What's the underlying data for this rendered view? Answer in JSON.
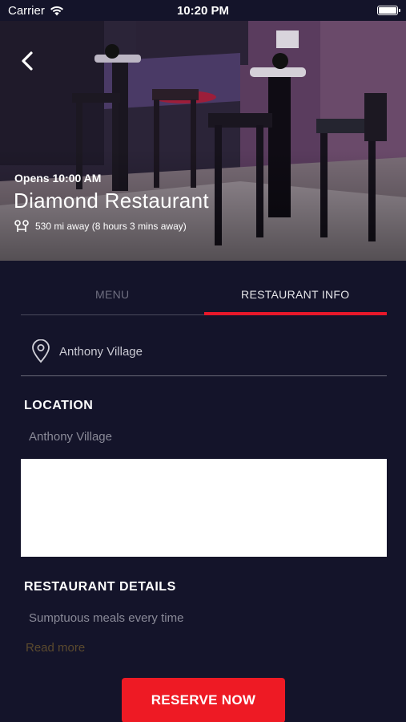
{
  "status_bar": {
    "carrier": "Carrier",
    "time": "10:20 PM"
  },
  "hero": {
    "opens": "Opens 10:00 AM",
    "name": "Diamond Restaurant",
    "distance": "530 mi away (8 hours 3 mins away)"
  },
  "tabs": [
    {
      "label": "MENU",
      "active": false
    },
    {
      "label": "RESTAURANT INFO",
      "active": true
    }
  ],
  "address": "Anthony Village",
  "location": {
    "title": "LOCATION",
    "value": "Anthony Village"
  },
  "details": {
    "title": "RESTAURANT DETAILS",
    "description": "Sumptuous meals every time",
    "read_more": "Read more"
  },
  "reserve_button": "RESERVE NOW",
  "colors": {
    "background": "#14142a",
    "accent": "#ee1a24",
    "read_more": "#5b4a2e"
  }
}
